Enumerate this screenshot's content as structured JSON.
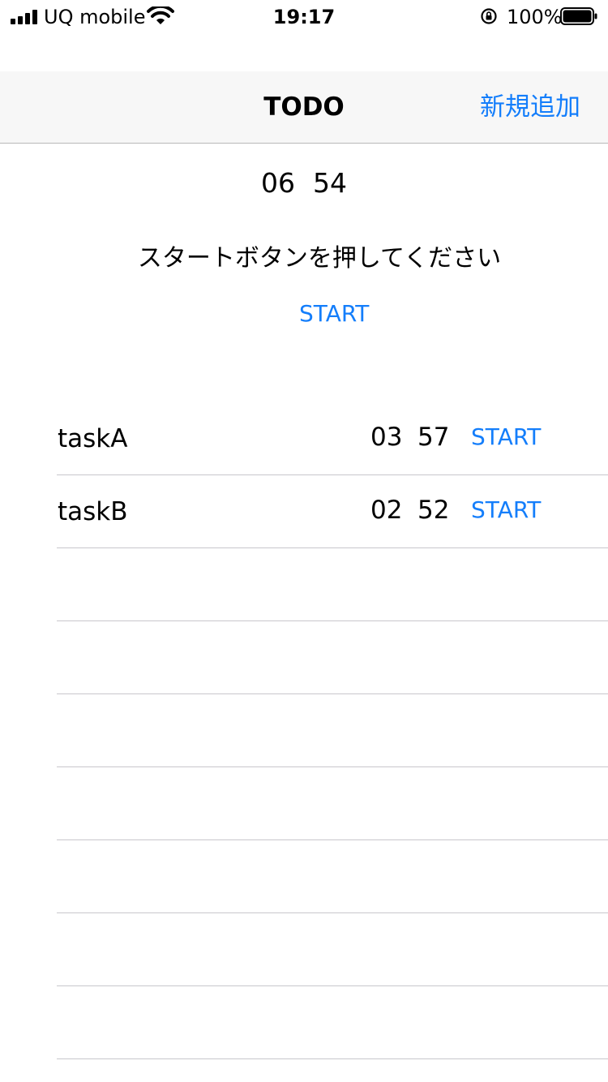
{
  "status_bar": {
    "carrier": "UQ mobile",
    "time": "19:17",
    "battery_percent": "100%",
    "icons": [
      "signal-icon",
      "wifi-icon",
      "rotation-lock-icon",
      "battery-icon"
    ]
  },
  "nav": {
    "title": "TODO",
    "add_button": "新規追加"
  },
  "main": {
    "timer_minutes": "06",
    "timer_seconds": "54",
    "message": "スタートボタンを押してください",
    "start_label": "START"
  },
  "tasks": [
    {
      "name": "taskA",
      "minutes": "03",
      "seconds": "57",
      "start_label": "START"
    },
    {
      "name": "taskB",
      "minutes": "02",
      "seconds": "52",
      "start_label": "START"
    }
  ],
  "colors": {
    "accent": "#147efb",
    "nav_background": "#f7f7f7",
    "separator": "#c8c7cc"
  }
}
